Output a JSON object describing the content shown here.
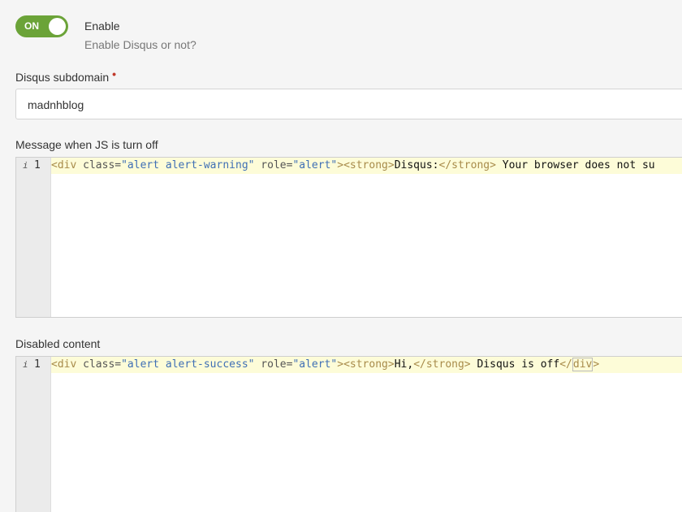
{
  "enable": {
    "toggle_label": "ON",
    "title": "Enable",
    "description": "Enable Disqus or not?"
  },
  "subdomain": {
    "label": "Disqus subdomain",
    "required_mark": "•",
    "value": "madnhblog"
  },
  "js_off": {
    "label": "Message when JS is turn off",
    "line_number": "1",
    "info_icon": "i",
    "code": {
      "t1": "<div",
      "t2": " class",
      "t3": "=",
      "t4": "\"alert alert-warning\"",
      "t5": " role",
      "t6": "=",
      "t7": "\"alert\"",
      "t8": "><strong>",
      "t9": "Disqus:",
      "t10": "</strong>",
      "t11": " Your browser does not su"
    }
  },
  "disabled": {
    "label": "Disabled content",
    "line_number": "1",
    "info_icon": "i",
    "code": {
      "t1": "<div",
      "t2": " class",
      "t3": "=",
      "t4": "\"alert alert-success\"",
      "t5": " role",
      "t6": "=",
      "t7": "\"alert\"",
      "t8": "><strong>",
      "t9": "Hi,",
      "t10": "</strong>",
      "t11": " Disqus is off",
      "t12": "</",
      "t13": "div",
      "t14": ">"
    }
  }
}
